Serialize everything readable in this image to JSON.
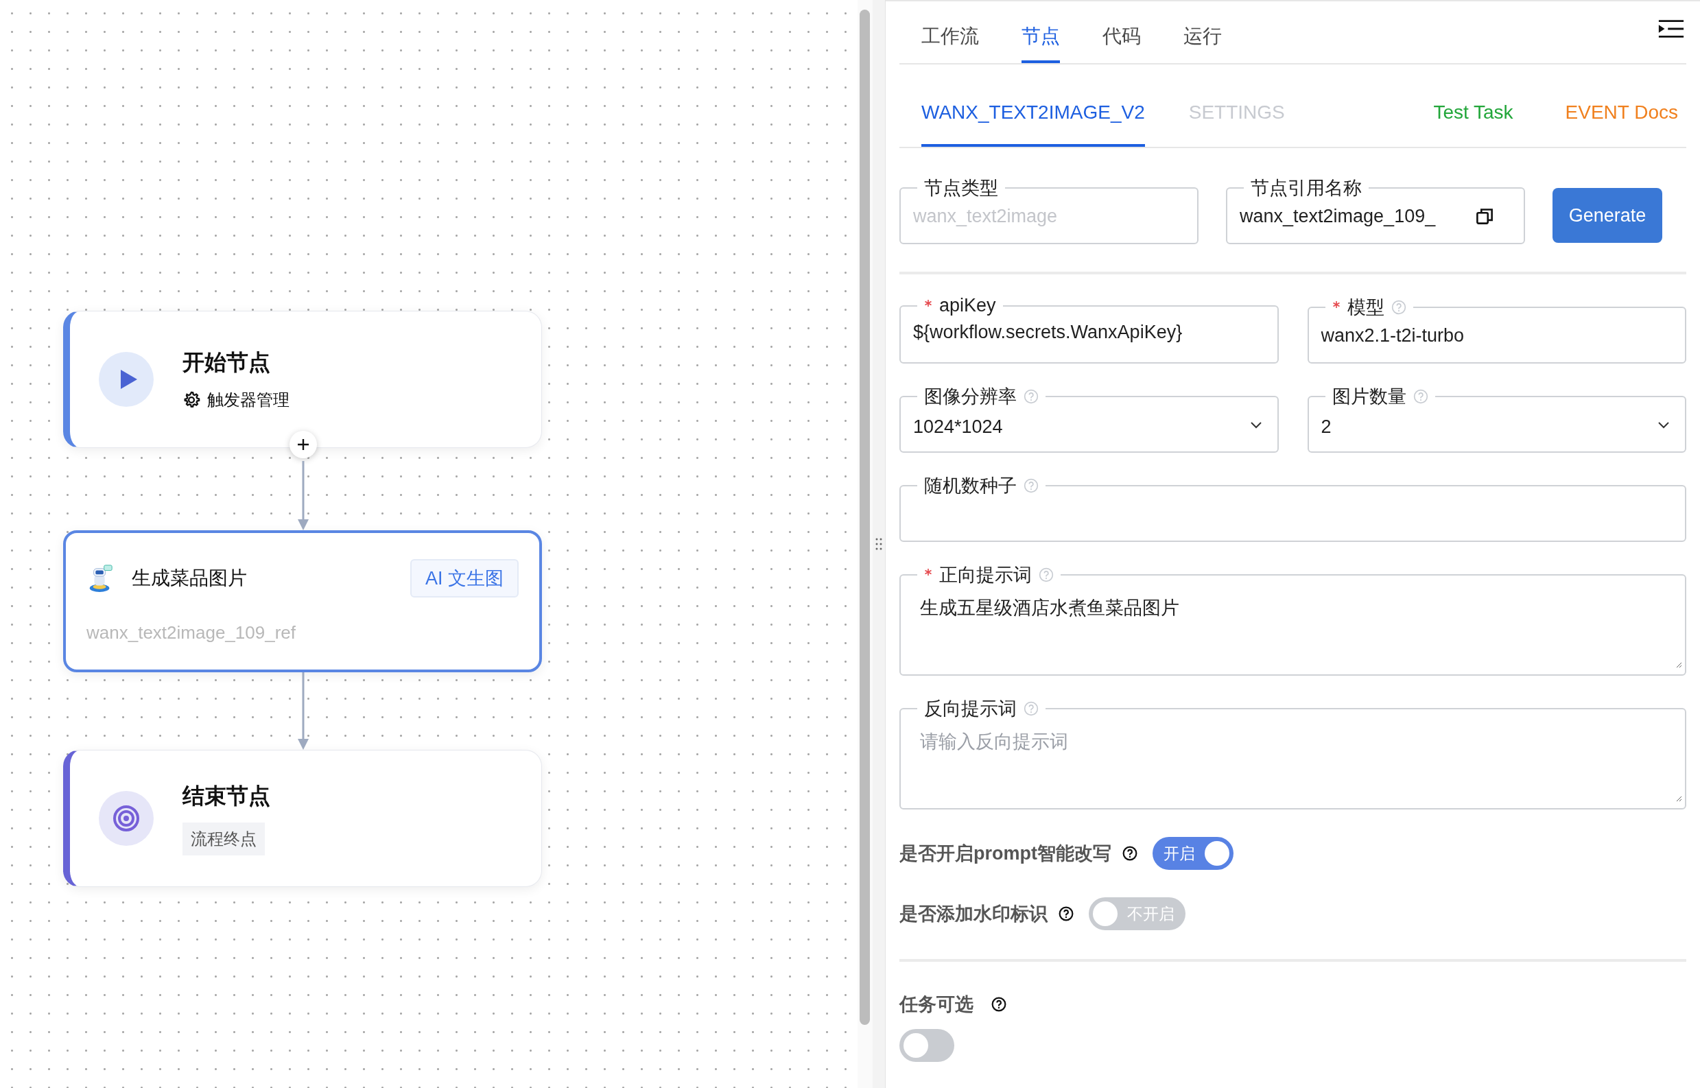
{
  "canvas": {
    "nodes": [
      {
        "kind": "start",
        "title": "开始节点",
        "action": "触发器管理",
        "selected": false
      },
      {
        "kind": "task",
        "title": "生成菜品图片",
        "tag": "AI 文生图",
        "ref": "wanx_text2image_109_ref",
        "selected": true
      },
      {
        "kind": "end",
        "title": "结束节点",
        "badge": "流程终点",
        "selected": false
      }
    ]
  },
  "panel": {
    "tabs": [
      {
        "label": "工作流",
        "selected": false
      },
      {
        "label": "节点",
        "selected": true
      },
      {
        "label": "代码",
        "selected": false
      },
      {
        "label": "运行",
        "selected": false
      }
    ],
    "sub_tabs": [
      {
        "label": "WANX_TEXT2IMAGE_V2",
        "selected": true
      },
      {
        "label": "SETTINGS",
        "selected": false
      }
    ],
    "links": [
      {
        "label": "Test Task",
        "color": "#22a63a"
      },
      {
        "label": "EVENT Docs",
        "color": "#f0801e"
      }
    ],
    "header_fields": [
      {
        "label": "节点类型",
        "value": "wanx_text2image",
        "disabled": true,
        "copy": false
      },
      {
        "label": "节点引用名称",
        "value": "wanx_text2image_109_",
        "disabled": false,
        "copy": true
      }
    ],
    "generate_button": "Generate",
    "form_rows": [
      [
        {
          "kind": "text",
          "label": "apiKey",
          "required": true,
          "help": false,
          "value": "${workflow.secrets.WanxApiKey}"
        },
        {
          "kind": "text",
          "label": "模型",
          "required": true,
          "help": true,
          "value": "wanx2.1-t2i-turbo"
        }
      ],
      [
        {
          "kind": "select",
          "label": "图像分辨率",
          "required": false,
          "help": true,
          "value": "1024*1024"
        },
        {
          "kind": "select",
          "label": "图片数量",
          "required": false,
          "help": true,
          "value": "2"
        }
      ],
      [
        {
          "kind": "text",
          "label": "随机数种子",
          "required": false,
          "help": true
        }
      ],
      [
        {
          "kind": "textarea",
          "label": "正向提示词",
          "required": true,
          "help": true,
          "value": "生成五星级酒店水煮鱼菜品图片"
        }
      ],
      [
        {
          "kind": "textarea",
          "label": "反向提示词",
          "required": false,
          "help": true,
          "placeholder": "请输入反向提示词"
        }
      ]
    ],
    "switches": [
      {
        "label": "是否开启prompt智能改写",
        "on": true,
        "text": "开启"
      },
      {
        "label": "是否添加水印标识",
        "on": false,
        "text": "不开启"
      }
    ],
    "optional_task": {
      "label": "任务可选",
      "on": false
    }
  }
}
